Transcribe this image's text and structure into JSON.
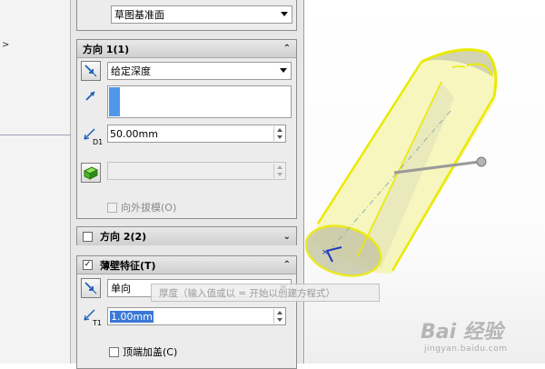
{
  "left_strip": {
    "arrow": ">"
  },
  "top_group": {
    "plane_select": "草图基准面"
  },
  "direction1": {
    "title": "方向 1(1)",
    "end_condition": "给定深度",
    "depth_value": "50.00mm",
    "draft_outward_label": "向外拔模(O)"
  },
  "direction2": {
    "title": "方向 2(2)"
  },
  "thin_feature": {
    "title": "薄壁特征(T)",
    "type_select": "单向",
    "thickness_value": "1.00mm",
    "cap_ends_label": "顶端加盖(C)"
  },
  "tooltip": {
    "text": "厚度（输入值或以 = 开始以创建方程式）"
  },
  "watermark": {
    "brand": "Bai 经验",
    "url": "jingyan.baidu.com"
  },
  "colors": {
    "accent": "#3a79d4",
    "model_yellow": "#f2f23c"
  },
  "icons": [
    "reverse-direction-icon",
    "direction-arrow-icon",
    "depth-dimension-icon",
    "draft-toggle-icon",
    "thickness-dimension-icon",
    "collapse-up-icon",
    "expand-down-icon"
  ]
}
